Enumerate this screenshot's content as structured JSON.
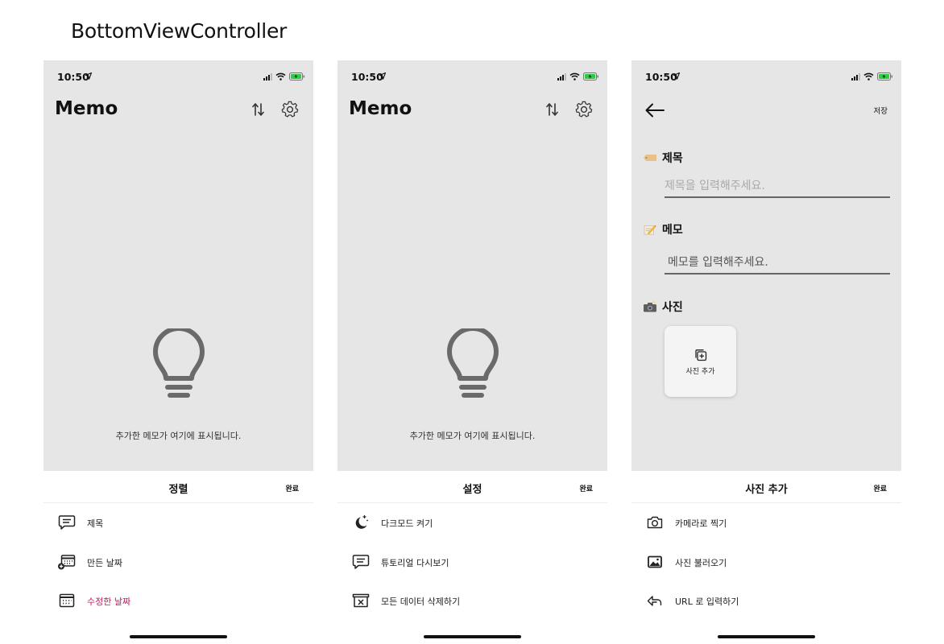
{
  "page_title": "BottomViewController",
  "colors": {
    "screen_bg": "#e6e6e6",
    "active_option": "#c2185b",
    "battery": "#2ecc40"
  },
  "phones": [
    {
      "status_time": "10:50",
      "title": "Memo",
      "header_icons": [
        "sort-icon",
        "settings-gear-icon"
      ],
      "empty_text": "추가한 메모가 여기에 표시됩니다.",
      "sheet": {
        "title": "정렬",
        "done": "완료",
        "options": [
          {
            "icon": "title-chat-icon",
            "label": "제목",
            "active": false
          },
          {
            "icon": "calendar-add-icon",
            "label": "만든 날짜",
            "active": false
          },
          {
            "icon": "calendar-icon",
            "label": "수정한 날짜",
            "active": true
          }
        ]
      }
    },
    {
      "status_time": "10:50",
      "title": "Memo",
      "header_icons": [
        "sort-icon",
        "settings-gear-icon"
      ],
      "empty_text": "추가한 메모가 여기에 표시됩니다.",
      "sheet": {
        "title": "설정",
        "done": "완료",
        "options": [
          {
            "icon": "moon-stars-icon",
            "label": "다크모드 켜기",
            "active": false
          },
          {
            "icon": "chat-icon",
            "label": "튜토리얼 다시보기",
            "active": false
          },
          {
            "icon": "archive-delete-icon",
            "label": "모든 데이터 삭제하기",
            "active": false
          }
        ]
      }
    },
    {
      "status_time": "10:50",
      "save": "저장",
      "sections": {
        "title_label": "제목",
        "title_placeholder": "제목을 입력해주세요.",
        "memo_label": "메모",
        "memo_placeholder": "메모를 입력해주세요.",
        "photo_label": "사진",
        "add_photo": "사진 추가"
      },
      "sheet": {
        "title": "사진 추가",
        "done": "완료",
        "options": [
          {
            "icon": "camera-icon",
            "label": "카메라로 찍기",
            "active": false
          },
          {
            "icon": "image-icon",
            "label": "사진 불러오기",
            "active": false
          },
          {
            "icon": "link-share-icon",
            "label": "URL 로 입력하기",
            "active": false
          }
        ]
      }
    }
  ]
}
